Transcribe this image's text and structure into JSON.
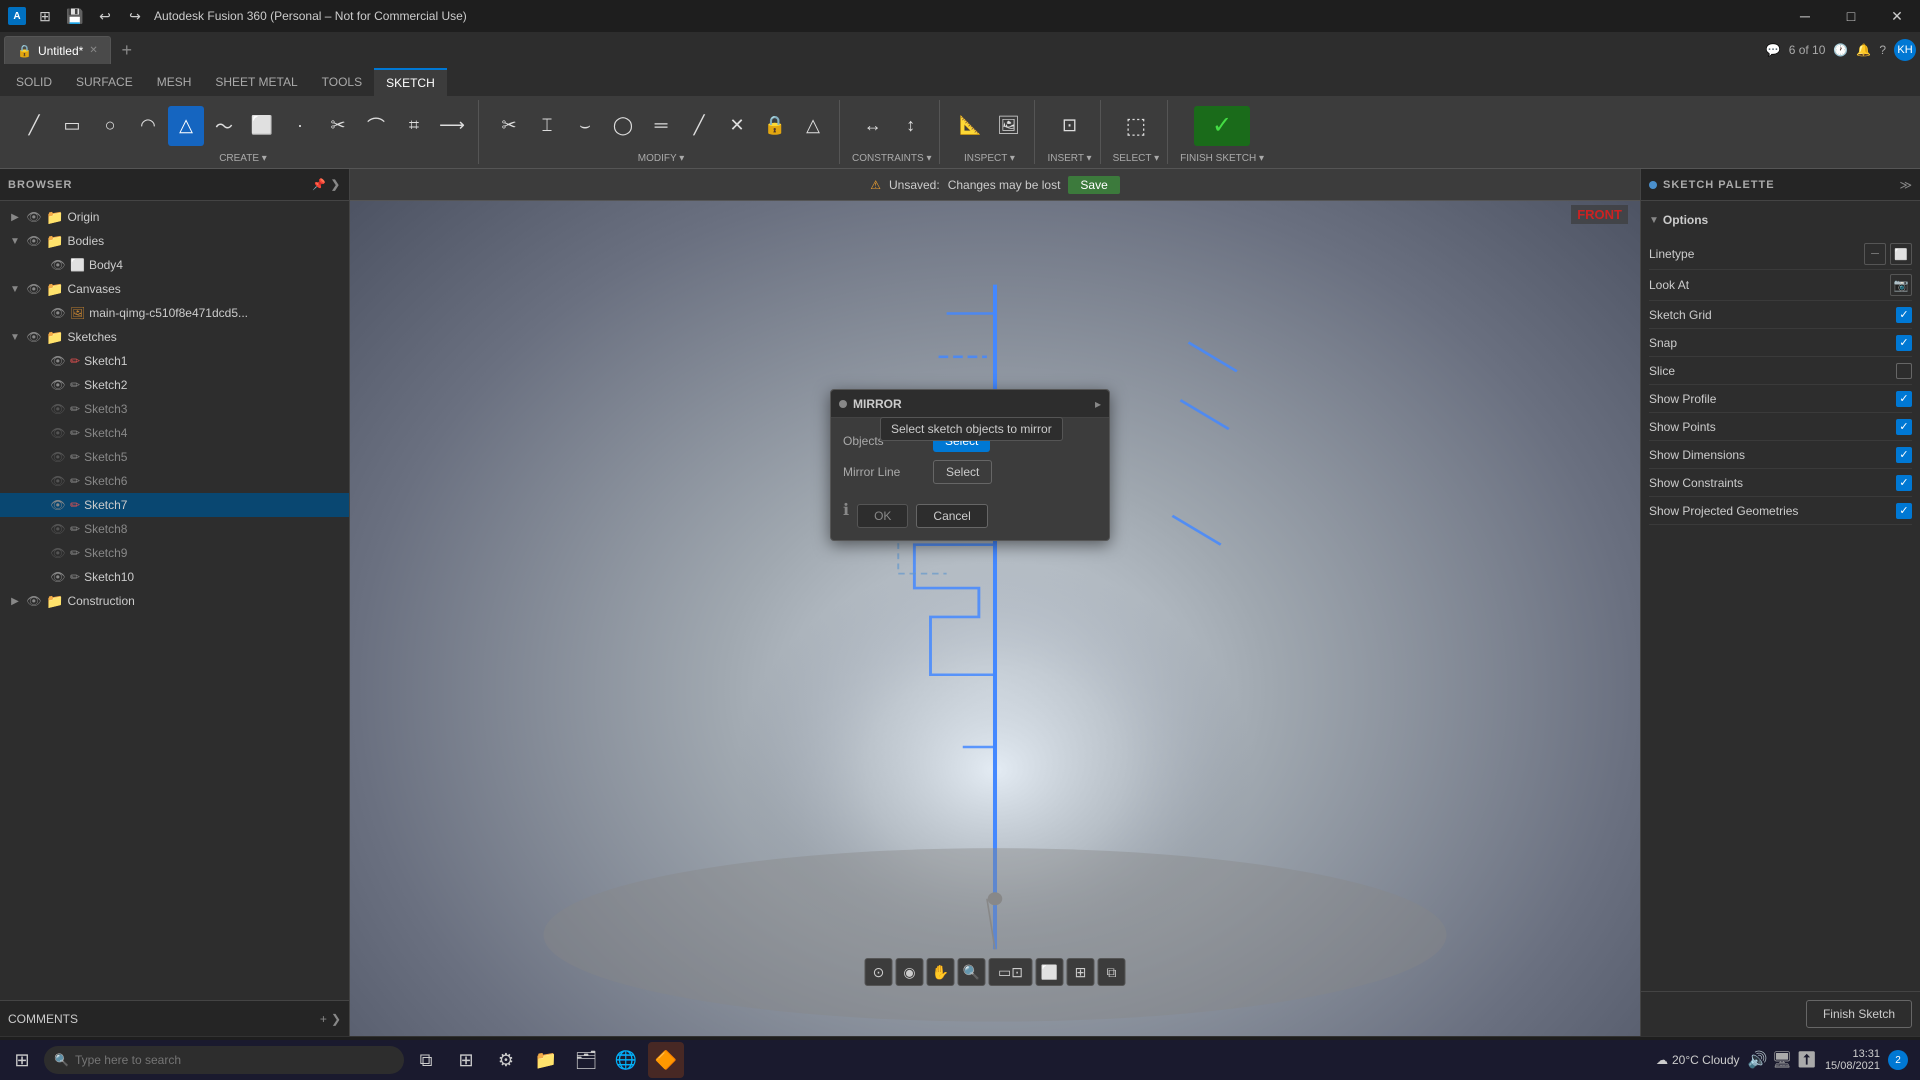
{
  "app": {
    "title": "Autodesk Fusion 360 (Personal – Not for Commercial Use)",
    "tab_title": "Untitled*",
    "tab_count": "6 of 10"
  },
  "ribbon": {
    "tabs": [
      "SOLID",
      "SURFACE",
      "MESH",
      "SHEET METAL",
      "TOOLS",
      "SKETCH"
    ],
    "active_tab": "SKETCH",
    "groups": {
      "create": {
        "label": "CREATE",
        "tools": [
          "line",
          "rectangle",
          "circle",
          "arc",
          "polygon",
          "spline",
          "conic",
          "point",
          "text",
          "mirror",
          "offset",
          "project"
        ]
      },
      "modify": {
        "label": "MODIFY",
        "tools": [
          "trim",
          "extend",
          "break",
          "fillet",
          "offset_curve"
        ]
      },
      "constraints": {
        "label": "CONSTRAINTS"
      },
      "inspect": {
        "label": "INSPECT"
      },
      "insert": {
        "label": "INSERT"
      },
      "select": {
        "label": "SELECT"
      },
      "finish": {
        "label": "FINISH SKETCH"
      }
    }
  },
  "sidebar": {
    "title": "BROWSER",
    "items": [
      {
        "label": "Origin",
        "level": 1,
        "type": "folder",
        "expanded": false
      },
      {
        "label": "Bodies",
        "level": 1,
        "type": "folder",
        "expanded": true
      },
      {
        "label": "Body4",
        "level": 2,
        "type": "body"
      },
      {
        "label": "Canvases",
        "level": 1,
        "type": "folder",
        "expanded": true
      },
      {
        "label": "main-qimg-c510f8e471dcd5...",
        "level": 2,
        "type": "canvas"
      },
      {
        "label": "Sketches",
        "level": 1,
        "type": "folder",
        "expanded": true
      },
      {
        "label": "Sketch1",
        "level": 2,
        "type": "sketch"
      },
      {
        "label": "Sketch2",
        "level": 2,
        "type": "sketch"
      },
      {
        "label": "Sketch3",
        "level": 2,
        "type": "sketch"
      },
      {
        "label": "Sketch4",
        "level": 2,
        "type": "sketch"
      },
      {
        "label": "Sketch5",
        "level": 2,
        "type": "sketch"
      },
      {
        "label": "Sketch6",
        "level": 2,
        "type": "sketch"
      },
      {
        "label": "Sketch7",
        "level": 2,
        "type": "sketch",
        "active": true
      },
      {
        "label": "Sketch8",
        "level": 2,
        "type": "sketch"
      },
      {
        "label": "Sketch9",
        "level": 2,
        "type": "sketch"
      },
      {
        "label": "Sketch10",
        "level": 2,
        "type": "sketch"
      },
      {
        "label": "Construction",
        "level": 1,
        "type": "folder",
        "expanded": false
      }
    ]
  },
  "unsaved": {
    "icon": "⚠",
    "text": "Unsaved:",
    "detail": "Changes may be lost",
    "save_label": "Save"
  },
  "view_label": "FRONT",
  "mirror_dialog": {
    "title": "MIRROR",
    "objects_label": "Objects",
    "mirror_line_label": "Mirror Line",
    "select_btn": "Select",
    "select_btn2": "Select",
    "ok_btn": "OK",
    "cancel_btn": "Cancel",
    "tooltip": "Select sketch objects to mirror"
  },
  "sketch_palette": {
    "title": "SKETCH PALETTE",
    "options_label": "Options",
    "linetype_label": "Linetype",
    "lookat_label": "Look At",
    "sketch_grid_label": "Sketch Grid",
    "sketch_grid_checked": true,
    "snap_label": "Snap",
    "snap_checked": true,
    "slice_label": "Slice",
    "slice_checked": false,
    "show_profile_label": "Show Profile",
    "show_profile_checked": true,
    "show_points_label": "Show Points",
    "show_points_checked": true,
    "show_dimensions_label": "Show Dimensions",
    "show_dimensions_checked": true,
    "show_constraints_label": "Show Constraints",
    "show_constraints_checked": true,
    "show_projected_label": "Show Projected Geometries",
    "show_projected_checked": true,
    "finish_sketch_btn": "Finish Sketch"
  },
  "comments": {
    "label": "COMMENTS"
  },
  "taskbar": {
    "search_placeholder": "Type here to search",
    "weather": "20°C  Cloudy",
    "time": "13:31",
    "date": "15/08/2021",
    "notif_count": "2"
  }
}
